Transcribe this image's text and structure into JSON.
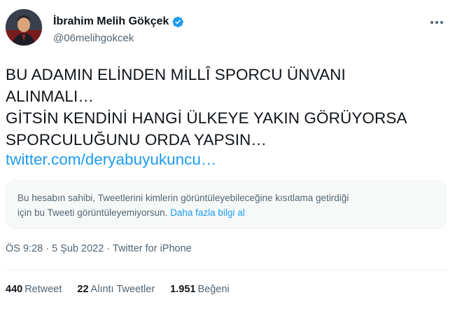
{
  "author": {
    "name": "İbrahim Melih Gökçek",
    "handle": "@06melihgokcek"
  },
  "tweet": {
    "lines": [
      "BU ADAMIN ELİNDEN MİLLÎ SPORCU ÜNVANI",
      "ALINMALI…",
      "GİTSİN KENDİNİ HANGİ ÜLKEYE YAKIN GÖRÜYORSA",
      "SPORCULUĞUNU ORDA YAPSIN…"
    ],
    "link": "twitter.com/deryabuyukuncu…"
  },
  "notice": {
    "line1": "Bu hesabın sahibi, Tweetlerini kimlerin görüntüleyebileceğine kısıtlama getirdiği",
    "line2": "için bu Tweeti görüntüleyemiyorsun.",
    "link": "Daha fazla bilgi al"
  },
  "meta": {
    "text": "ÖS 9:28 · 5 Şub 2022 · Twitter for iPhone"
  },
  "stats": {
    "retweets_count": "440",
    "retweets_label": "Retweet",
    "quotes_count": "22",
    "quotes_label": "Alıntı Tweetler",
    "likes_count": "1.951",
    "likes_label": "Beğeni"
  },
  "colors": {
    "accent": "#1d9bf0",
    "text": "#0f1419",
    "secondary": "#536471"
  },
  "icons": {
    "verified": "verified-badge-icon",
    "more": "more-options-icon"
  }
}
